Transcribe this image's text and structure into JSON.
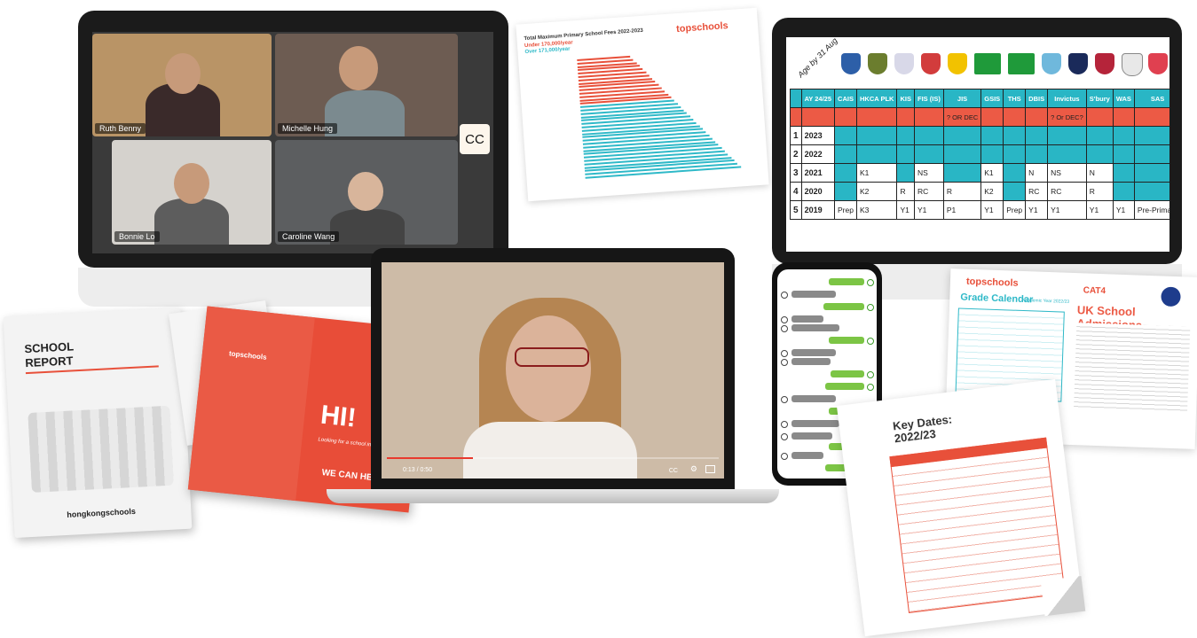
{
  "video_call": {
    "participants": [
      {
        "name": "Ruth Benny"
      },
      {
        "name": "Michelle Hung"
      },
      {
        "name": "Bonnie Lo"
      },
      {
        "name": "Caroline Wang"
      }
    ],
    "cc_label": "CC"
  },
  "fees_chart": {
    "title": "Total Maximum Primary School Fees 2022-2023",
    "under_label": "Under 170,000/year",
    "over_label": "Over 171,000/year",
    "brand": "topschools"
  },
  "chart_data": {
    "type": "bar",
    "title": "Total Maximum Primary School Fees 2022-2023",
    "series": [
      {
        "name": "Under 170,000/year",
        "color": "#e8503a",
        "count": 14
      },
      {
        "name": "Over 171,000/year",
        "color": "#2fb9c8",
        "count": 22
      }
    ]
  },
  "admissions_table": {
    "age_label": "Age by 31 Aug",
    "headers": [
      "AY 24/25",
      "CAIS",
      "HKCA PLK",
      "KIS",
      "FIS (IS)",
      "JIS",
      "GSIS",
      "THS",
      "DBIS",
      "Invictus",
      "S'bury",
      "WAS",
      "SAS"
    ],
    "note_row": [
      "",
      "",
      "",
      "",
      "",
      "? OR DEC",
      "",
      "",
      "",
      "? Or DEC?",
      "",
      "",
      ""
    ],
    "rows": [
      {
        "n": "1",
        "year": "2023",
        "cells": [
          "",
          "",
          "",
          "",
          "",
          "",
          "",
          "",
          "",
          "",
          "",
          ""
        ]
      },
      {
        "n": "2",
        "year": "2022",
        "cells": [
          "",
          "",
          "",
          "",
          "",
          "",
          "",
          "",
          "",
          "",
          "",
          ""
        ]
      },
      {
        "n": "3",
        "year": "2021",
        "cells": [
          "",
          "K1",
          "",
          "NS",
          "",
          "K1",
          "",
          "N",
          "NS",
          "N",
          "",
          ""
        ]
      },
      {
        "n": "4",
        "year": "2020",
        "cells": [
          "",
          "K2",
          "R",
          "RC",
          "R",
          "K2",
          "",
          "RC",
          "RC",
          "R",
          "",
          ""
        ]
      },
      {
        "n": "5",
        "year": "2019",
        "cells": [
          "Prep",
          "K3",
          "Y1",
          "Y1",
          "P1",
          "Y1",
          "Prep",
          "Y1",
          "Y1",
          "Y1",
          "Y1",
          "Pre-Primary"
        ]
      }
    ]
  },
  "school_report": {
    "title_line1": "SCHOOL",
    "title_line2": "REPORT",
    "brand": "hongkongschools"
  },
  "brochure": {
    "brand": "topschools",
    "headline": "HI!",
    "tagline": "Looking for a school in Hong Kong?",
    "cta": "WE CAN HELP!"
  },
  "video_player": {
    "time": "0:13 / 0:50",
    "progress": 0.26,
    "cc": "CC"
  },
  "grade_calendar": {
    "brand": "topschools",
    "title": "Grade Calendar",
    "year": "Academic Year 2022/23",
    "cat": "CAT4",
    "headline": "UK School Admissions"
  },
  "key_dates": {
    "title_line1": "Key Dates:",
    "title_line2": "2022/23"
  }
}
